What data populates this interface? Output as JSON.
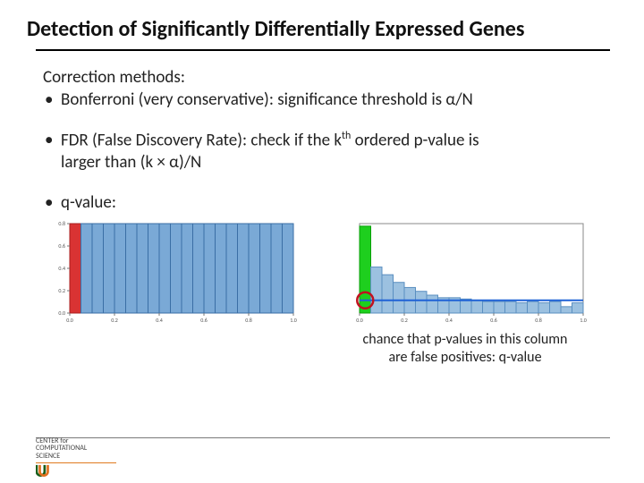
{
  "title": "Detection of Significantly Differentially Expressed Genes",
  "correction_label": "Correction methods:",
  "bullet_bonferroni_pre": "Bonferroni (very conservative): significance threshold is ",
  "alpha": "α",
  "bullet_bonferroni_post": "/N",
  "bullet_fdr_pre": "FDR (False Discovery Rate): check if the k",
  "th": "th",
  "bullet_fdr_mid": " ordered p-value is",
  "bullet_fdr_line2": "larger than (k × α)/N",
  "bullet_qvalue": "q-value:",
  "caption_l1": "chance that p-values in this column",
  "caption_l2": "are false positives: q-value",
  "footer_center": "CENTER for",
  "footer_comp": "COMPUTATIONAL",
  "footer_sci": "SCIENCE",
  "chart_data": [
    {
      "type": "bar",
      "title": "",
      "xlabel": "",
      "ylabel": "",
      "xlim": [
        0.0,
        1.0
      ],
      "ylim": [
        0.0,
        0.8
      ],
      "x_ticks": [
        0.0,
        0.2,
        0.4,
        0.6,
        0.8,
        1.0
      ],
      "y_ticks": [
        0.0,
        0.2,
        0.4,
        0.6,
        0.8
      ],
      "bin_edges": [
        0.0,
        0.05,
        0.1,
        0.15,
        0.2,
        0.25,
        0.3,
        0.35,
        0.4,
        0.45,
        0.5,
        0.55,
        0.6,
        0.65,
        0.7,
        0.75,
        0.8,
        0.85,
        0.9,
        0.95,
        1.0
      ],
      "values": [
        0.8,
        0.8,
        0.8,
        0.8,
        0.8,
        0.8,
        0.8,
        0.8,
        0.8,
        0.8,
        0.8,
        0.8,
        0.8,
        0.8,
        0.8,
        0.8,
        0.8,
        0.8,
        0.8,
        0.8
      ],
      "highlight_bin_index": 0,
      "highlight_color": "#d93333"
    },
    {
      "type": "bar",
      "title": "",
      "xlabel": "",
      "ylabel": "",
      "xlim": [
        0.0,
        1.0
      ],
      "ylim": [
        0.0,
        0.7
      ],
      "x_ticks": [
        0.0,
        0.2,
        0.4,
        0.6,
        0.8,
        1.0
      ],
      "bin_edges": [
        0.0,
        0.05,
        0.1,
        0.15,
        0.2,
        0.25,
        0.3,
        0.35,
        0.4,
        0.45,
        0.5,
        0.55,
        0.6,
        0.65,
        0.7,
        0.75,
        0.8,
        0.85,
        0.9,
        0.95,
        1.0
      ],
      "values": [
        0.68,
        0.36,
        0.3,
        0.24,
        0.2,
        0.17,
        0.14,
        0.12,
        0.12,
        0.11,
        0.1,
        0.09,
        0.09,
        0.09,
        0.08,
        0.09,
        0.08,
        0.09,
        0.05,
        0.08
      ],
      "highlight_bin_index": 0,
      "highlight_color": "#1ecf1e",
      "reference_line_y": 0.1,
      "circled_point": {
        "x": 0.025,
        "y": 0.1
      }
    }
  ]
}
